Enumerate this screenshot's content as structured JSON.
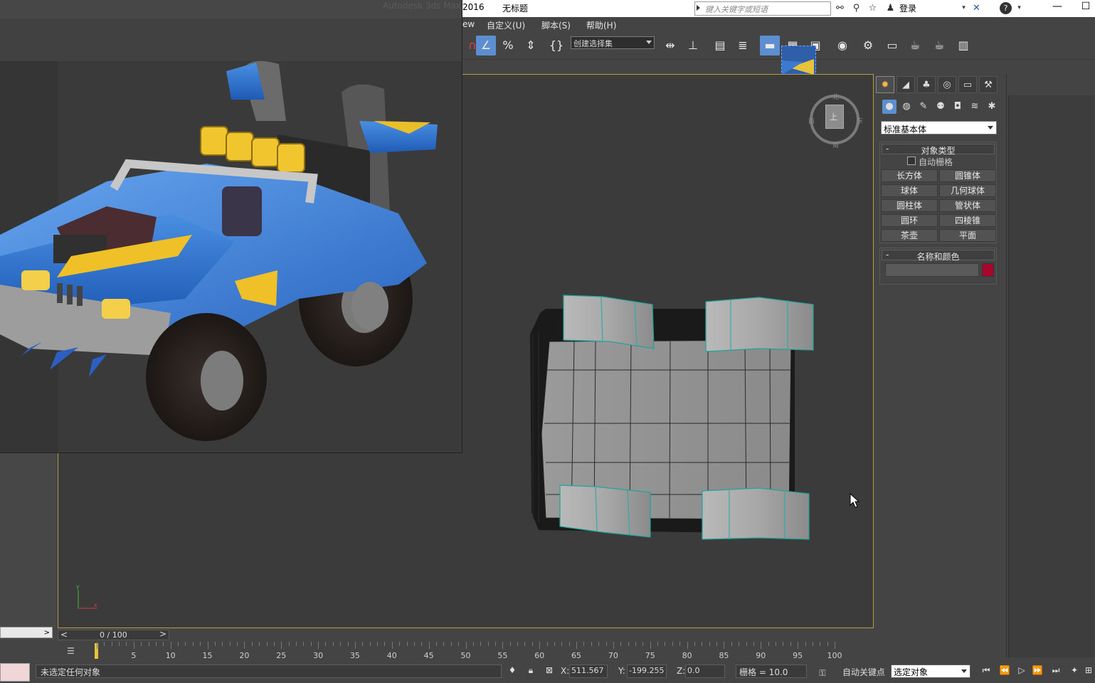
{
  "titlebar": {
    "year": "2016",
    "doc_title": "无标题",
    "search_placeholder": "键入关键字或短语",
    "login": "登录",
    "ref_title_faded": "Autodesk 3ds Max"
  },
  "menubar": {
    "items": [
      "ew",
      "自定义(U)",
      "脚本(S)",
      "帮助(H)"
    ]
  },
  "toolbar": {
    "selection_set_placeholder": "创建选择集"
  },
  "viewcube": {
    "face": "上",
    "north": "北",
    "south": "南",
    "east": "东",
    "west": "西"
  },
  "command_panel": {
    "category": "标准基本体",
    "object_type": {
      "title": "对象类型",
      "autogrid": "自动栅格",
      "buttons": [
        "长方体",
        "圆锥体",
        "球体",
        "几何球体",
        "圆柱体",
        "管状体",
        "圆环",
        "四棱锥",
        "茶壶",
        "平面"
      ]
    },
    "name_color": {
      "title": "名称和颜色",
      "name_value": "",
      "color": "#a8072b"
    }
  },
  "time_slider": {
    "label": "0 / 100",
    "prev": "<",
    "next": ">",
    "ticks": [
      "5",
      "10",
      "15",
      "20",
      "25",
      "30",
      "35",
      "40",
      "45",
      "50",
      "55",
      "60",
      "65",
      "70",
      "75",
      "80",
      "85",
      "90",
      "95",
      "100"
    ]
  },
  "status": {
    "message": "未选定任何对象",
    "x_label": "X:",
    "x_value": "511.567",
    "y_label": "Y:",
    "y_value": "-199.255",
    "z_label": "Z:",
    "z_value": "0.0",
    "grid": "栅格 = 10.0",
    "autokey": "自动关键点",
    "key_filter": "选定对象"
  }
}
